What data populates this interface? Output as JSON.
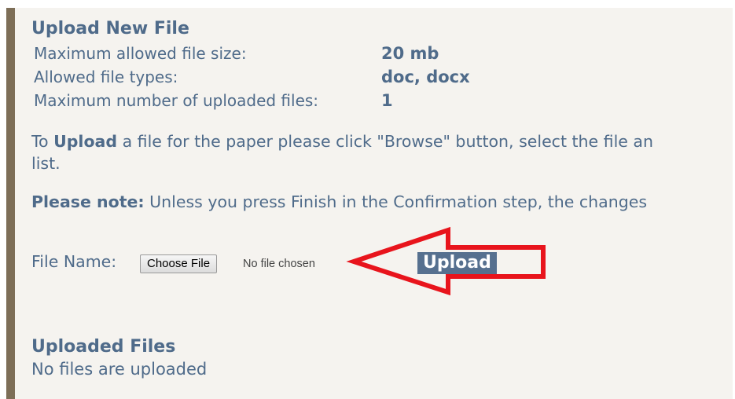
{
  "upload_section": {
    "title": "Upload New File",
    "info": [
      {
        "label": "Maximum allowed file size:",
        "value": "20 mb"
      },
      {
        "label": "Allowed file types:",
        "value": "doc, docx"
      },
      {
        "label": "Maximum number of uploaded files:",
        "value": "1"
      }
    ],
    "instructions": {
      "prefix": "To ",
      "bold_word": "Upload",
      "rest_line1": " a file for the paper please click \"Browse\" button, select the file an",
      "line2": "list."
    },
    "note": {
      "label": "Please note:",
      "text": " Unless you press Finish in the Confirmation step, the changes"
    },
    "file_name_label": "File Name:",
    "choose_file_label": "Choose File",
    "no_file_text": "No file chosen",
    "upload_button_label": "Upload"
  },
  "uploaded_section": {
    "title": "Uploaded Files",
    "status": "No files are uploaded"
  },
  "colors": {
    "text": "#4f6b8a",
    "panel_bg": "#f5f3ef",
    "left_border": "#7d6e57",
    "upload_button_bg": "#56708f",
    "annotation_arrow": "#e8141c"
  },
  "annotation": {
    "type": "arrow",
    "direction": "left"
  }
}
